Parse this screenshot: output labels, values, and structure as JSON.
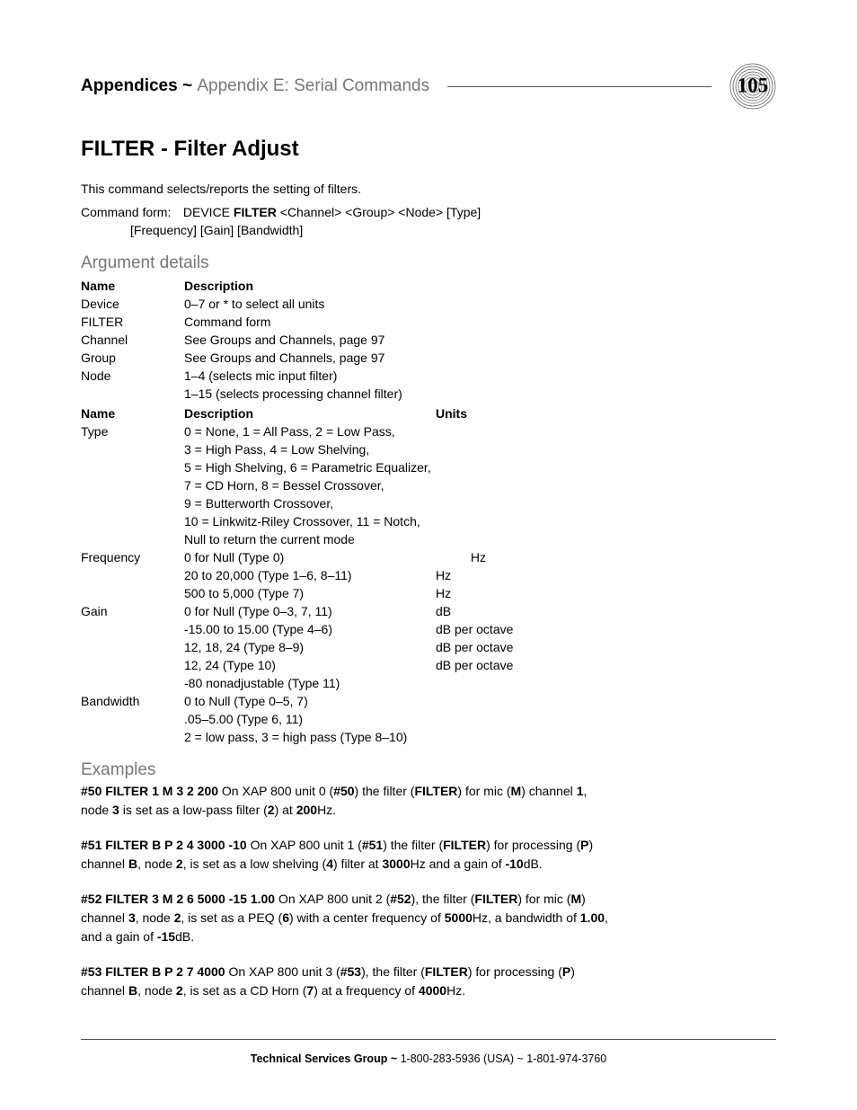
{
  "header": {
    "breadcrumb_bold": "Appendices ~ ",
    "breadcrumb_light": "Appendix E: Serial Commands",
    "page_number": "105"
  },
  "title": "FILTER - Filter Adjust",
  "intro": "This command selects/reports the setting of filters.",
  "cmdform": {
    "label": "Command form:",
    "line1_pre": "DEVICE ",
    "line1_bold": "FILTER",
    "line1_post": " <Channel> <Group> <Node> [Type]",
    "line2": "[Frequency] [Gain] [Bandwidth]"
  },
  "arg_section_title": "Argument details",
  "table1_headers": {
    "c1": "Name",
    "c2": "Description"
  },
  "table1": [
    {
      "name": "Device",
      "desc": "0–7 or * to select all units"
    },
    {
      "name": "FILTER",
      "desc": "Command form"
    },
    {
      "name": "Channel",
      "desc": "See Groups and Channels, page 97"
    },
    {
      "name": "Group",
      "desc": "See Groups and Channels, page 97"
    },
    {
      "name": "Node",
      "desc": "1–4 (selects mic input filter)"
    },
    {
      "name": "",
      "desc": "1–15 (selects processing channel filter)"
    }
  ],
  "table2_headers": {
    "c1": "Name",
    "c2": "Description",
    "c3": "Units"
  },
  "table2": [
    {
      "name": "Type",
      "desc": "0 = None,  1 = All Pass,  2 = Low Pass,",
      "units": ""
    },
    {
      "name": "",
      "desc": "3 = High Pass, 4 = Low Shelving,",
      "units": ""
    },
    {
      "name": "",
      "desc": "5 = High Shelving, 6 = Parametric Equalizer,",
      "units": ""
    },
    {
      "name": "",
      "desc": "7 = CD Horn, 8 = Bessel Crossover,",
      "units": ""
    },
    {
      "name": "",
      "desc": "9 = Butterworth Crossover,",
      "units": ""
    },
    {
      "name": "",
      "desc": "10 = Linkwitz-Riley Crossover, 11 = Notch,",
      "units": ""
    },
    {
      "name": "",
      "desc": "Null to return the current mode",
      "units": ""
    },
    {
      "name": "Frequency",
      "desc": "0 for Null (Type 0)",
      "units": "          Hz"
    },
    {
      "name": "",
      "desc": "20 to 20,000 (Type 1–6, 8–11)",
      "units": "Hz"
    },
    {
      "name": "",
      "desc": "500 to 5,000 (Type 7)",
      "units": "Hz"
    },
    {
      "name": "Gain",
      "desc": "0 for Null (Type 0–3, 7, 11)",
      "units": "dB"
    },
    {
      "name": "",
      "desc": "-15.00 to 15.00 (Type 4–6)",
      "units": "dB per octave"
    },
    {
      "name": "",
      "desc": "12, 18, 24 (Type 8–9)",
      "units": "dB per octave"
    },
    {
      "name": "",
      "desc": "12, 24 (Type 10)",
      "units": "dB per octave"
    },
    {
      "name": "",
      "desc": "-80 nonadjustable (Type 11)",
      "units": ""
    },
    {
      "name": "Bandwidth",
      "desc": "0 to Null (Type 0–5, 7)",
      "units": ""
    },
    {
      "name": "",
      "desc": ".05–5.00 (Type 6, 11)",
      "units": ""
    },
    {
      "name": "",
      "desc": "2 = low pass, 3 = high pass (Type 8–10)",
      "units": ""
    }
  ],
  "examples_title": "Examples",
  "examples": [
    "<b>#50 FILTER 1 M 3 2 200</b>  On XAP 800 unit 0 (<b>#50</b>) the filter (<b>FILTER</b>) for mic (<b>M</b>) channel <b>1</b>, node <b>3</b> is set as a low-pass filter (<b>2</b>) at <b>200</b>Hz.",
    "<b>#51 FILTER B P 2 4 3000 -10</b>  On XAP 800 unit 1 (<b>#51</b>) the filter (<b>FILTER</b>) for processing (<b>P</b>) channel <b>B</b>, node <b>2</b>, is set as a low shelving (<b>4</b>) filter at <b>3000</b>Hz and a gain of <b>-10</b>dB.",
    "<b>#52 FILTER 3 M 2 6 5000 -15 1.00</b>  On XAP 800 unit 2 (<b>#52</b>), the filter (<b>FILTER</b>) for mic (<b>M</b>) channel <b>3</b>, node <b>2</b>, is set as a PEQ (<b>6</b>) with a center frequency of <b>5000</b>Hz, a bandwidth of <b>1.00</b>, and a gain of <b>-15</b>dB.",
    "<b>#53 FILTER B P 2 7 4000</b>  On XAP 800 unit 3 (<b>#53</b>), the filter (<b>FILTER</b>) for processing (<b>P</b>) channel <b>B</b>, node <b>2</b>, is set as a CD Horn (<b>7</b>) at a frequency of <b>4000</b>Hz."
  ],
  "footer": {
    "bold": "Technical Services Group ~ ",
    "rest": "1-800-283-5936 (USA) ~ 1-801-974-3760"
  }
}
